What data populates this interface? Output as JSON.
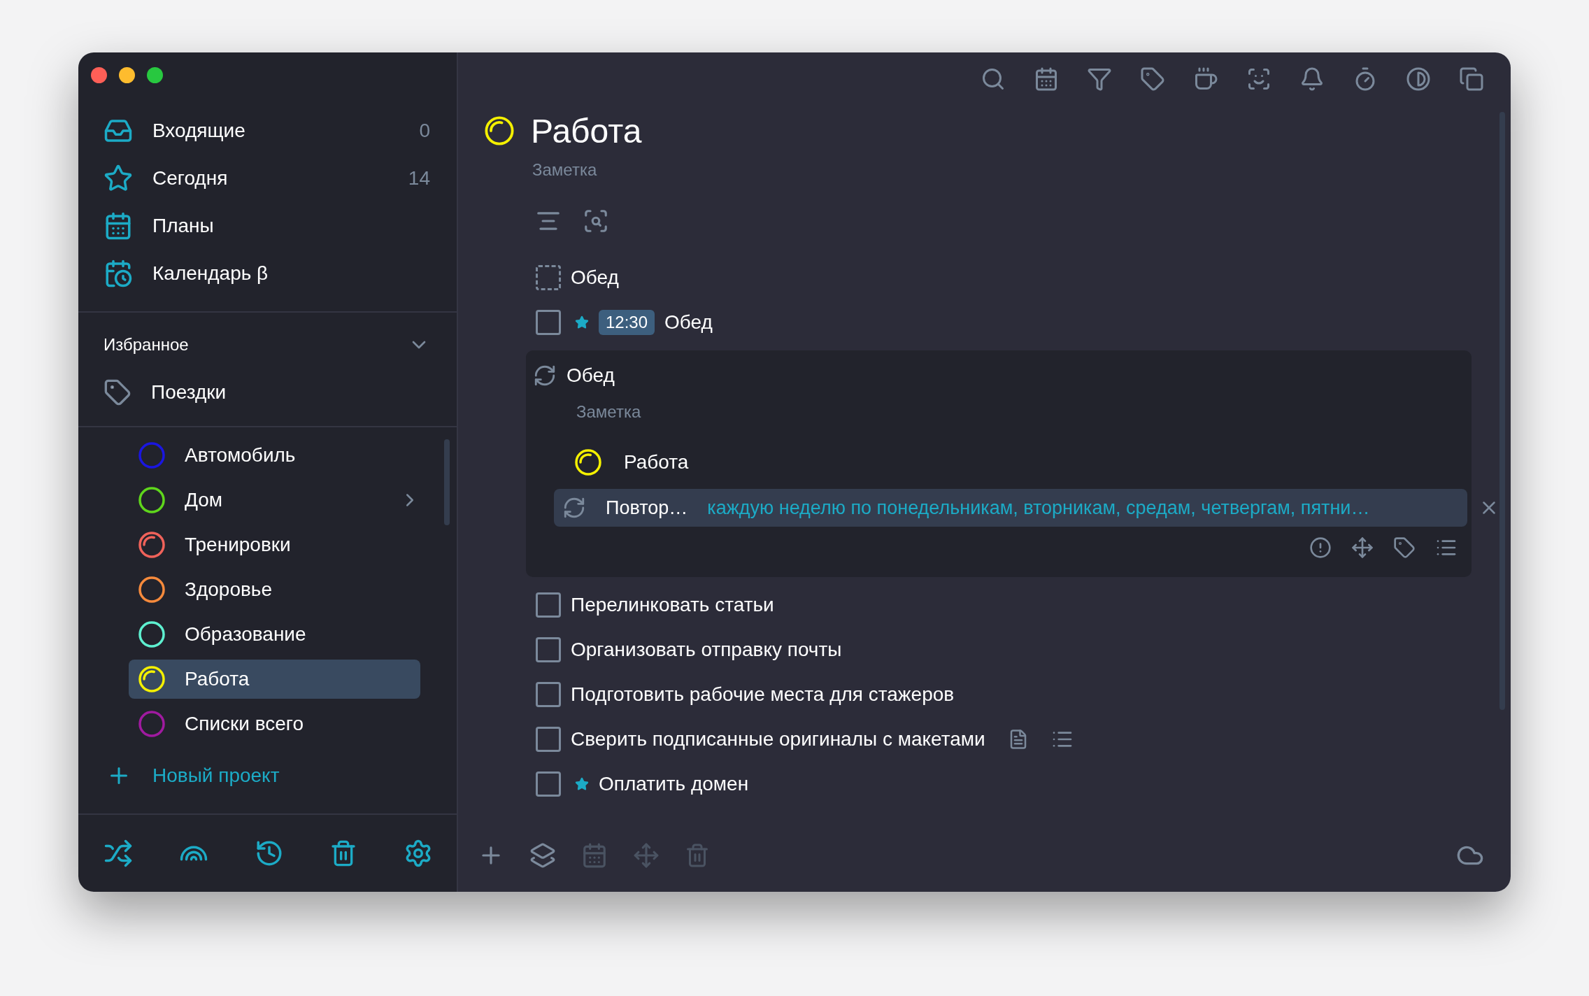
{
  "sidebar": {
    "nav": [
      {
        "label": "Входящие",
        "count": "0"
      },
      {
        "label": "Сегодня",
        "count": "14"
      },
      {
        "label": "Планы"
      },
      {
        "label": "Календарь β"
      }
    ],
    "favorites": {
      "title": "Избранное",
      "expanded": true,
      "items": [
        {
          "label": "Поездки"
        }
      ]
    },
    "projects": [
      {
        "label": "Автомобиль",
        "color": "#1a16e0",
        "started": false,
        "has_subprojects": false,
        "selected": false
      },
      {
        "label": "Дом",
        "color": "#5fd61c",
        "started": false,
        "has_subprojects": true,
        "selected": false
      },
      {
        "label": "Тренировки",
        "color": "#f0625a",
        "started": true,
        "has_subprojects": false,
        "selected": false
      },
      {
        "label": "Здоровье",
        "color": "#f68a3c",
        "started": false,
        "has_subprojects": false,
        "selected": false
      },
      {
        "label": "Образование",
        "color": "#5ef0d0",
        "started": false,
        "has_subprojects": false,
        "selected": false
      },
      {
        "label": "Работа",
        "color": "#f4f000",
        "started": true,
        "has_subprojects": false,
        "selected": true
      },
      {
        "label": "Списки всего",
        "color": "#a01aa0",
        "started": false,
        "has_subprojects": false,
        "selected": false
      }
    ],
    "new_project": "Новый проект"
  },
  "main": {
    "title": "Работа",
    "color": "#f4f000",
    "started": true,
    "note": "Заметка",
    "tasks": [
      {
        "kind": "dashed",
        "title": "Обед",
        "starred": false,
        "checked": false,
        "has_note": false,
        "has_checklist": false
      },
      {
        "kind": "task",
        "title": "Обед",
        "starred": true,
        "time": "12:30",
        "checked": false,
        "has_note": false,
        "has_checklist": false
      },
      {
        "kind": "expanded",
        "title": "Обед",
        "note": "Заметка",
        "project": {
          "label": "Работа",
          "color": "#f4f000",
          "started": true
        },
        "repeat": {
          "label": "Повтор…",
          "value": "каждую неделю по понедельникам, вторникам, средам, четвергам, пятни…"
        }
      },
      {
        "kind": "task",
        "title": "Перелинковать статьи",
        "starred": false,
        "checked": false,
        "has_note": false,
        "has_checklist": false
      },
      {
        "kind": "task",
        "title": "Организовать отправку почты",
        "starred": false,
        "checked": false,
        "has_note": false,
        "has_checklist": false
      },
      {
        "kind": "task",
        "title": "Подготовить рабочие места для стажеров",
        "starred": false,
        "checked": false,
        "has_note": false,
        "has_checklist": false
      },
      {
        "kind": "task",
        "title": "Сверить подписанные оригиналы с макетами",
        "starred": false,
        "checked": false,
        "has_note": true,
        "has_checklist": true
      },
      {
        "kind": "task",
        "title": "Оплатить домен",
        "starred": true,
        "checked": false,
        "has_note": false,
        "has_checklist": false
      }
    ]
  }
}
